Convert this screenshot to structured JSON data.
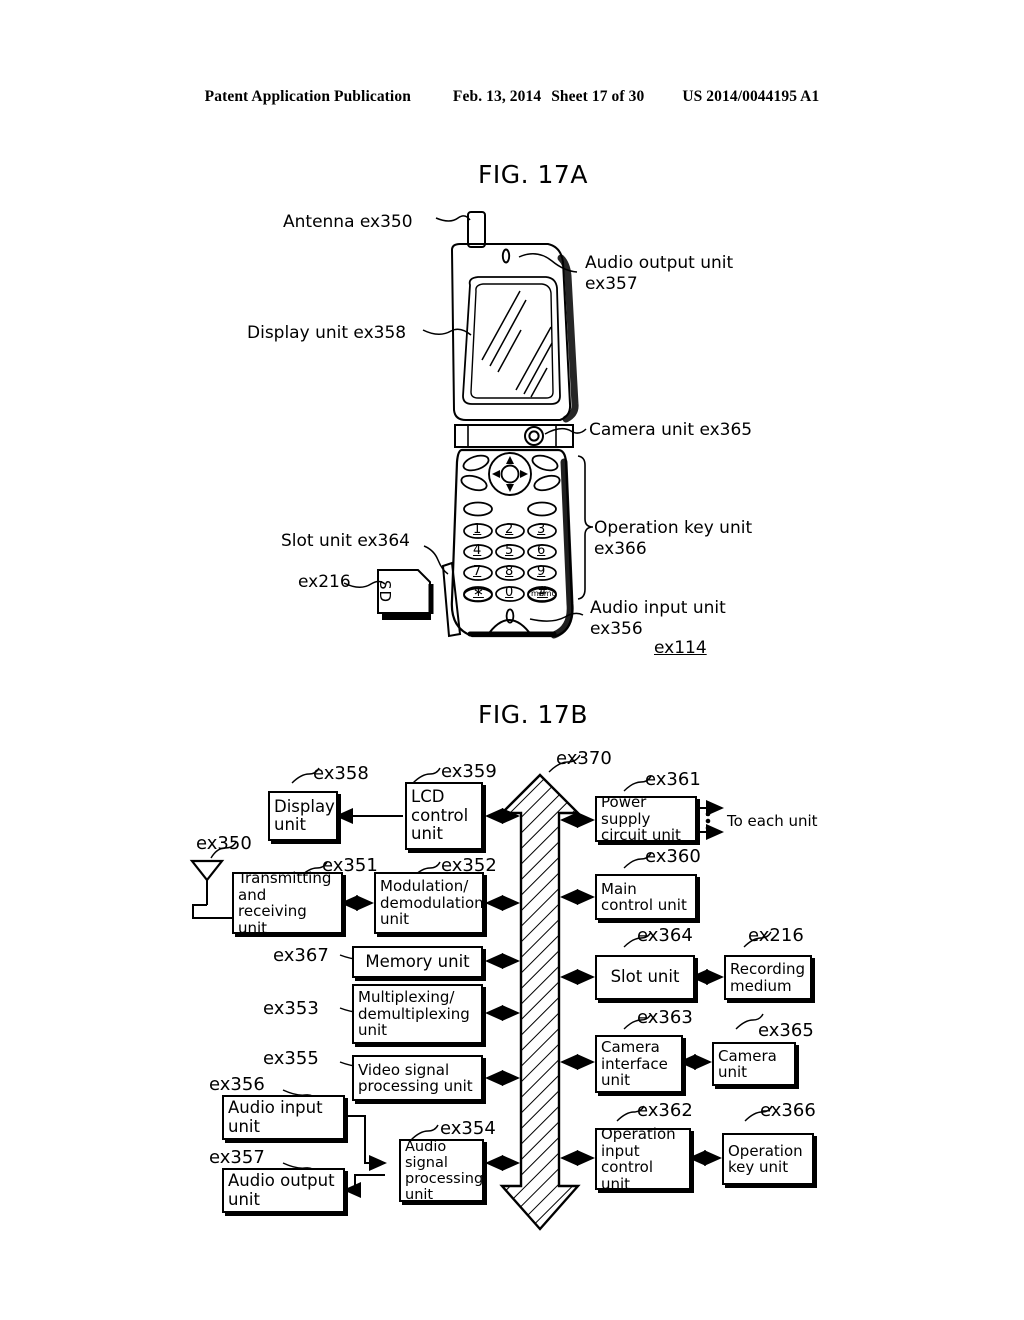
{
  "header": {
    "publication": "Patent Application Publication",
    "date": "Feb. 13, 2014",
    "sheet": "Sheet 17 of 30",
    "patent_number": "US 2014/0044195 A1"
  },
  "fig17a": {
    "title": "FIG. 17A",
    "labels": {
      "antenna": "Antenna ex350",
      "display_unit": "Display unit ex358",
      "audio_output_line1": "Audio output unit",
      "audio_output_line2": "ex357",
      "camera_unit": "Camera unit ex365",
      "operation_key_line1": "Operation key unit",
      "operation_key_line2": "ex366",
      "slot_unit": "Slot unit ex364",
      "ex216": "ex216",
      "audio_input_line1": "Audio input unit",
      "audio_input_line2": "ex356",
      "device_ref": "ex114"
    },
    "sd_card_text": "SD",
    "keypad": {
      "rows": [
        [
          "1",
          "2",
          "3"
        ],
        [
          "4",
          "5",
          "6"
        ],
        [
          "7",
          "8",
          "9"
        ],
        [
          "∗",
          "0",
          "#"
        ]
      ],
      "memo_key": "memo"
    }
  },
  "fig17b": {
    "title": "FIG. 17B",
    "bus_ref": "ex370",
    "antenna_ref": "ex350",
    "to_each_unit": "To each unit",
    "left_blocks": [
      {
        "ref": "ex358",
        "label": "Display\nunit"
      },
      {
        "ref": "ex359",
        "label": "LCD\ncontrol\nunit"
      },
      {
        "ref": "ex351",
        "label": "Transmitting\nand receiving\nunit"
      },
      {
        "ref": "ex352",
        "label": "Modulation/\ndemodulation\nunit"
      },
      {
        "ref": "ex367",
        "label": "Memory unit"
      },
      {
        "ref": "ex353",
        "label": "Multiplexing/\ndemultiplexing\nunit"
      },
      {
        "ref": "ex355",
        "label": "Video signal\nprocessing unit"
      },
      {
        "ref": "ex356",
        "label": "Audio input\nunit"
      },
      {
        "ref": "ex357",
        "label": "Audio output\nunit"
      },
      {
        "ref": "ex354",
        "label": "Audio signal\nprocessing\nunit"
      }
    ],
    "right_blocks": [
      {
        "ref": "ex361",
        "label": "Power supply\ncircuit unit"
      },
      {
        "ref": "ex360",
        "label": "Main\ncontrol unit"
      },
      {
        "ref": "ex364",
        "label": "Slot unit"
      },
      {
        "ref": "ex216",
        "label": "Recording\nmedium"
      },
      {
        "ref": "ex363",
        "label": "Camera\ninterface\nunit"
      },
      {
        "ref": "ex365",
        "label": "Camera\nunit"
      },
      {
        "ref": "ex362",
        "label": "Operation\ninput\ncontrol unit"
      },
      {
        "ref": "ex366",
        "label": "Operation\nkey unit"
      }
    ]
  }
}
